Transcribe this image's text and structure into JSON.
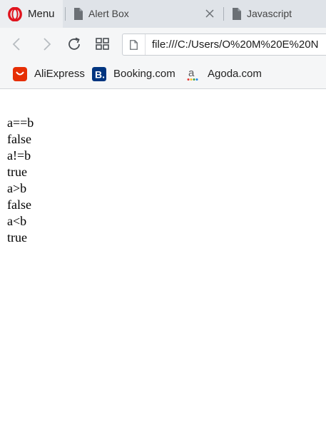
{
  "browser": {
    "menu_label": "Menu",
    "tabs": [
      {
        "title": "Alert Box",
        "icon": "document-icon",
        "active": true
      },
      {
        "title": "Javascript",
        "icon": "document-icon",
        "active": false
      }
    ],
    "address": {
      "url": "file:///C:/Users/O%20M%20E%20N"
    },
    "bookmarks": [
      {
        "label": "AliExpress",
        "icon": "aliexpress-icon",
        "color": "#e62e04"
      },
      {
        "label": "Booking.com",
        "icon": "booking-icon",
        "color": "#003580"
      },
      {
        "label": "Agoda.com",
        "icon": "agoda-icon",
        "color": "#5a5a5a"
      }
    ],
    "colors": {
      "opera_red": "#e0141e",
      "tabbar_bg": "#dfe3e8",
      "toolbar_bg": "#f5f6f7"
    }
  },
  "page": {
    "lines": [
      "a==b",
      "false",
      "a!=b",
      "true",
      "a>b",
      "false",
      "a<b",
      "true"
    ]
  }
}
